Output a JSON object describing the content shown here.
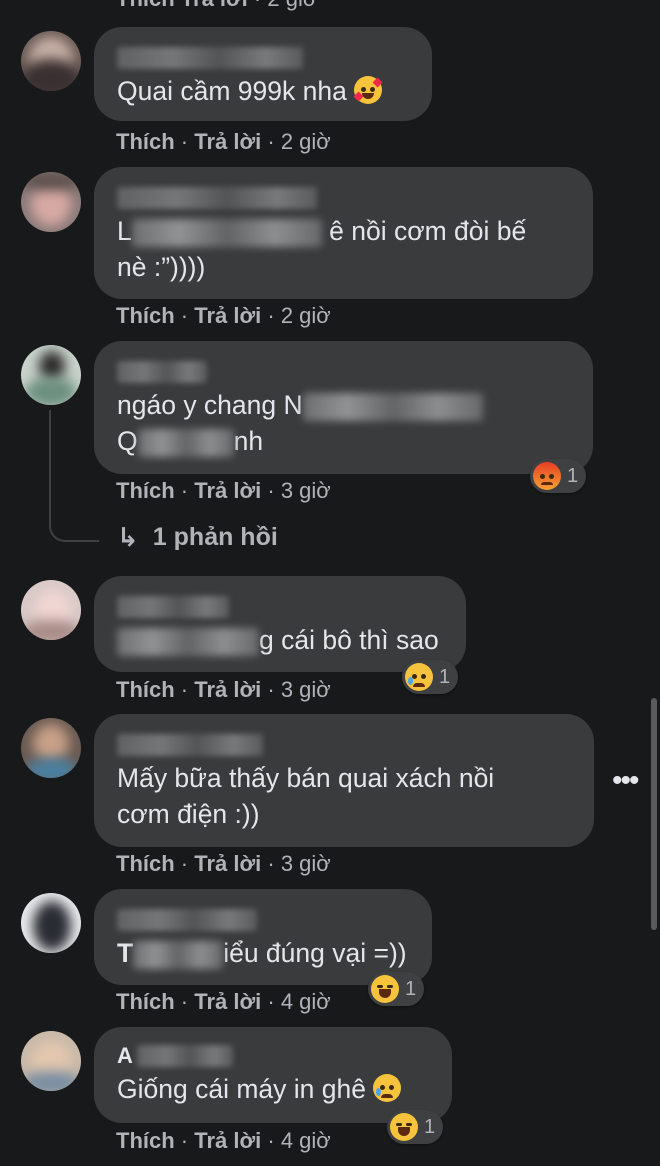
{
  "labels": {
    "like": "Thích",
    "reply": "Trả lời",
    "separator": "·"
  },
  "top_actions": {
    "time": "2 giờ"
  },
  "comments": [
    {
      "text_line1": "Quai cầm 999k nha",
      "time": "2 giờ",
      "trailing_emoji": "smiling-face-with-hearts"
    },
    {
      "text_line1_prefix": "L",
      "text_line1_suffix": "ê nồi cơm đòi bế",
      "text_line2": "nè :”))))",
      "time": "2 giờ"
    },
    {
      "text_line1_prefix": "ngáo y chang N",
      "text_line2_prefix": "Q",
      "text_line2_suffix": "nh",
      "time": "3 giờ",
      "reaction": {
        "icon": "angry-icon",
        "count": "1"
      },
      "replies_link": "1 phản hồi"
    },
    {
      "text_line1_suffix": "g cái bô thì sao",
      "time": "3 giờ",
      "reaction": {
        "icon": "sad-icon",
        "count": "1"
      }
    },
    {
      "text_line1": "Mấy bữa thấy bán quai xách nồi",
      "text_line2": "cơm điện :))",
      "time": "3 giờ",
      "more": "•••"
    },
    {
      "text_line1_prefix": "T",
      "text_line1_suffix": "iểu đúng vại =))",
      "time": "4 giờ",
      "reaction": {
        "icon": "laugh-icon",
        "count": "1"
      }
    },
    {
      "author_prefix": "A",
      "text_line1": "Giống cái máy in ghê",
      "time": "4 giờ",
      "trailing_emoji": "sad-crying",
      "reaction": {
        "icon": "laugh-icon",
        "count": "1"
      }
    }
  ]
}
